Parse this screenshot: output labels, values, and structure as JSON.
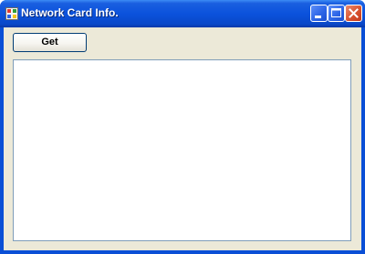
{
  "window": {
    "title": "Network Card Info.",
    "app_icon": "app-window-icon",
    "controls": {
      "minimize": "minimize-icon",
      "maximize": "maximize-icon",
      "close": "close-icon"
    }
  },
  "main": {
    "get_label": "Get",
    "info_text": ""
  },
  "colors": {
    "titlebar": "#0b52dc",
    "client_background": "#ece9d8",
    "close_button": "#d8532f",
    "textbox_border": "#7f9db9"
  }
}
